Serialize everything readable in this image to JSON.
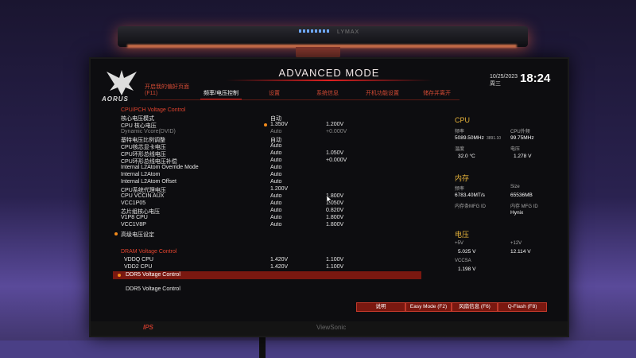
{
  "lamp": {
    "brand": "LYMAX"
  },
  "header": {
    "title": "ADVANCED MODE",
    "date": "10/25/2023",
    "weekday": "周三",
    "time": "18:24",
    "logo_text": "AORUS"
  },
  "tabs": [
    {
      "label": "开启我的偏好页面",
      "sublabel": "(F11)"
    },
    {
      "label": "频率/电压控制"
    },
    {
      "label": "设置"
    },
    {
      "label": "系统信息"
    },
    {
      "label": "开机功能设置"
    },
    {
      "label": "储存并离开"
    }
  ],
  "cpu_section_title": "CPU/PCH Voltage Control",
  "cpu_rows": [
    {
      "label": "核心电压模式",
      "v1": "自动",
      "v2": ""
    },
    {
      "label": "CPU 核心电压",
      "v1": "1.350V",
      "v2": "1.200V"
    },
    {
      "label": "Dynamic Vcore(DVID)",
      "v1": "Auto",
      "v2": "+0.000V"
    },
    {
      "label": "基特电压比例调整",
      "v1": "自动",
      "v2": ""
    },
    {
      "label": "CPU核芯显卡电压",
      "v1": "Auto",
      "v2": ""
    },
    {
      "label": "CPU环形总线电压",
      "v1": "Auto",
      "v2": "1.050V"
    },
    {
      "label": "CPU环形总线电压补偿",
      "v1": "Auto",
      "v2": "+0.000V"
    },
    {
      "label": "Internal L2Atom Override Mode",
      "v1": "Auto",
      "v2": ""
    },
    {
      "label": "Internal L2Atom",
      "v1": "Auto",
      "v2": ""
    },
    {
      "label": "Internal L2Atom Offset",
      "v1": "Auto",
      "v2": ""
    },
    {
      "label": "CPU系统代理电压",
      "v1": "1.200V",
      "v2": ""
    },
    {
      "label": "CPU VCCIN AUX",
      "v1": "Auto",
      "v2": "1.800V"
    },
    {
      "label": "VCC1P05",
      "v1": "Auto",
      "v2": "1.050V"
    },
    {
      "label": "芯片组核心电压",
      "v1": "Auto",
      "v2": "0.820V"
    },
    {
      "label": "V1P8 CPU",
      "v1": "Auto",
      "v2": "1.800V"
    },
    {
      "label": "VCC1V8P",
      "v1": "Auto",
      "v2": "1.800V"
    }
  ],
  "advanced_voltage": "高级电压设定",
  "dram_section_title": "DRAM Voltage Control",
  "dram_rows": [
    {
      "label": "VDDQ CPU",
      "v1": "1.420V",
      "v2": "1.100V"
    },
    {
      "label": "VDD2 CPU",
      "v1": "1.420V",
      "v2": "1.100V"
    }
  ],
  "ddr5_selected": "DDR5 Voltage Control",
  "ddr5_plain": "DDR5 Voltage Control",
  "right_panel": {
    "cpu_title": "CPU",
    "freq_label": "频率",
    "freq_value": "5089.50MHz",
    "freq_small": "3891.10",
    "ext_label": "CPU外频",
    "ext_value": "99.75MHz",
    "temp_label": "温度",
    "temp_value": "32.0 °C",
    "volt_label": "电压",
    "volt_value": "1.278 V",
    "mem_title": "内存",
    "mem_freq_label": "频率",
    "mem_freq_value": "6783.40MT/s",
    "size_label": "Size",
    "size_value": "65536MB",
    "mfg1_label": "内存条MFG ID",
    "mfg2_label": "内存 MFG ID",
    "mfg2_value": "Hynix",
    "volt_title": "电压",
    "p5_label": "+5V",
    "p5_value": "5.025 V",
    "p12_label": "+12V",
    "p12_value": "12.114 V",
    "vccsa_label": "VCCSA",
    "vccsa_value": "1.198 V"
  },
  "bottom_buttons": [
    {
      "label": "说明"
    },
    {
      "label": "Easy Mode (F2)"
    },
    {
      "label": "风扇信息 (F6)"
    },
    {
      "label": "Q-Flash (F8)"
    }
  ],
  "bezel": {
    "ips": "IPS",
    "brand": "ViewSonic"
  }
}
